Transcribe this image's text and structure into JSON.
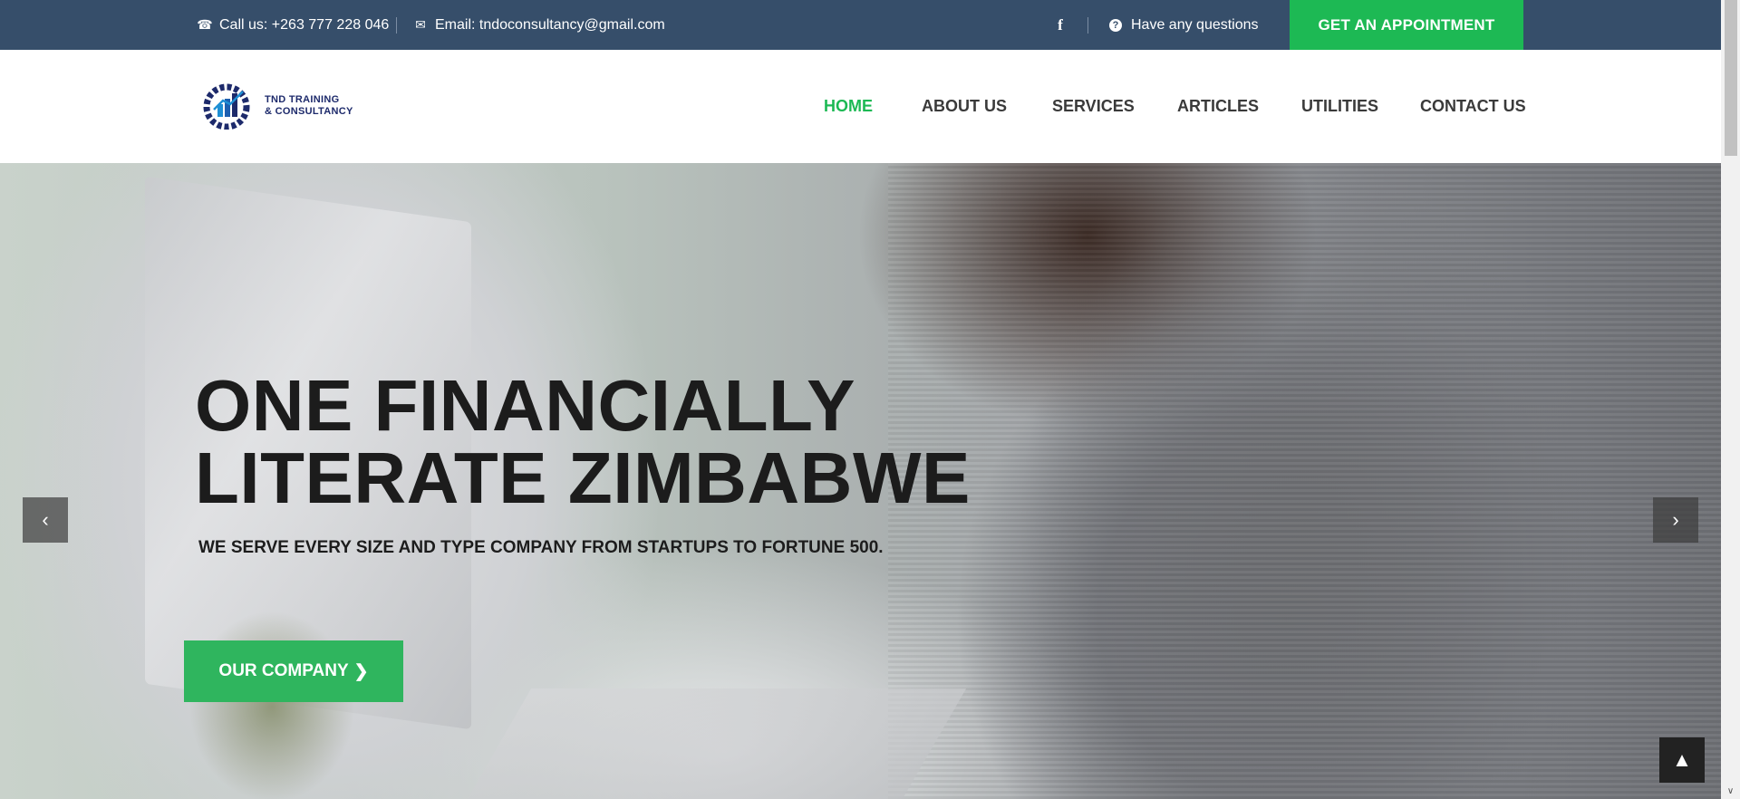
{
  "topbar": {
    "call_text": "Call us: +263 777 228 046",
    "email_text": "Email: tndoconsultancy@gmail.com",
    "facebook_glyph": "f",
    "questions_text": "Have any questions",
    "appointment_label": "GET AN APPOINTMENT",
    "background_color": "#364e6a",
    "accent_color": "#1db954"
  },
  "header": {
    "logo_line1": "TND TRAINING",
    "logo_line2": "& CONSULTANCY",
    "nav": [
      {
        "label": "HOME",
        "active": true
      },
      {
        "label": "ABOUT US",
        "active": false
      },
      {
        "label": "SERVICES",
        "active": false
      },
      {
        "label": "ARTICLES",
        "active": false
      },
      {
        "label": "UTILITIES",
        "active": false
      },
      {
        "label": "CONTACT US",
        "active": false
      }
    ]
  },
  "hero": {
    "title_line1": "ONE FINANCIALLY",
    "title_line2": "LITERATE ZIMBABWE",
    "subtitle": "WE SERVE EVERY SIZE AND TYPE COMPANY FROM STARTUPS TO FORTUNE 500.",
    "button_label": "OUR COMPANY",
    "button_color": "#2fb55e"
  },
  "icons": {
    "phone": "phone-icon",
    "email": "envelope-icon",
    "facebook": "facebook-icon",
    "question": "question-circle-icon",
    "prev": "chevron-left-icon",
    "next": "chevron-right-icon",
    "top": "chevron-up-icon"
  }
}
